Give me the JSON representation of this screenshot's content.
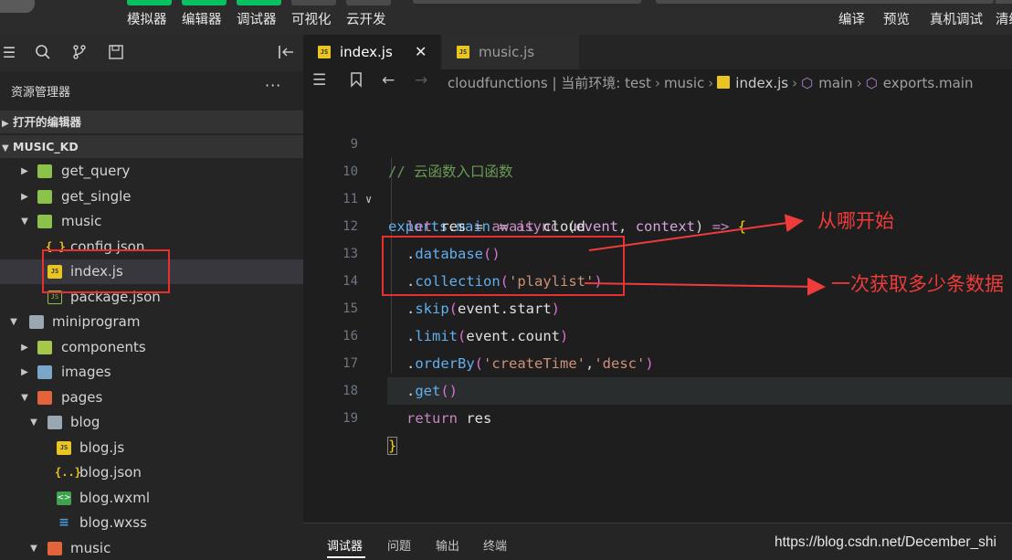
{
  "toolbar": {
    "buttons": [
      "模拟器",
      "编辑器",
      "调试器",
      "可视化",
      "云开发"
    ],
    "right_actions": [
      "编译",
      "预览",
      "真机调试",
      "清缓"
    ]
  },
  "sidebar": {
    "title": "资源管理器",
    "more": "···",
    "sections": [
      "打开的编辑器",
      "MUSIC_KD"
    ],
    "tree": [
      {
        "label": "get_query",
        "icon": "green-folder-icon"
      },
      {
        "label": "get_single",
        "icon": "green-folder-icon"
      },
      {
        "label": "music",
        "icon": "green-folder-open-icon"
      },
      {
        "label": "config.json",
        "icon": "json-file-icon"
      },
      {
        "label": "index.js",
        "icon": "js-file-icon"
      },
      {
        "label": "package.json",
        "icon": "package-json-icon"
      },
      {
        "label": "miniprogram",
        "icon": "folder-open-icon"
      },
      {
        "label": "components",
        "icon": "components-folder-icon"
      },
      {
        "label": "images",
        "icon": "images-folder-icon"
      },
      {
        "label": "pages",
        "icon": "pages-folder-icon"
      },
      {
        "label": "blog",
        "icon": "folder-open-icon"
      },
      {
        "label": "blog.js",
        "icon": "js-file-icon"
      },
      {
        "label": "blog.json",
        "icon": "json-file-icon"
      },
      {
        "label": "blog.wxml",
        "icon": "wxml-file-icon"
      },
      {
        "label": "blog.wxss",
        "icon": "wxss-file-icon"
      },
      {
        "label": "music",
        "icon": "red-folder-icon"
      }
    ]
  },
  "tabs": [
    {
      "label": "index.js",
      "close": "✕"
    },
    {
      "label": "music.js"
    }
  ],
  "breadcrumb": {
    "path": "cloudfunctions | 当前环境: test",
    "folder": "music",
    "file": "index.js",
    "symbol1": "main",
    "symbol2": "exports.main"
  },
  "code": {
    "line_numbers": [
      "9",
      "10",
      "11",
      "12",
      "13",
      "14",
      "15",
      "16",
      "17",
      "18",
      "19"
    ],
    "l9": "// 云函数入口函数",
    "l10_exports": "exports",
    "l10_dot": ".",
    "l10_main": "main",
    "l10_eq": " = ",
    "l10_async": "async",
    "l10_open": " (",
    "l10_event": "event",
    "l10_comma": ", ",
    "l10_context": "context",
    "l10_close": ")",
    "l10_arrow": " => ",
    "l10_brace": "{",
    "l11_let": "let",
    "l11_res": " res ",
    "l11_eq": "= ",
    "l11_await": "await",
    "l11_cloud": " cloud",
    "l12_dot": ".",
    "l12_fn": "database",
    "l12_paren": "()",
    "l13_dot": ".",
    "l13_fn": "collection",
    "l13_open": "(",
    "l13_str": "'playlist'",
    "l13_close": ")",
    "l14_dot": ".",
    "l14_fn": "skip",
    "l14_open": "(",
    "l14_arg": "event.start",
    "l14_close": ")",
    "l15_dot": ".",
    "l15_fn": "limit",
    "l15_open": "(",
    "l15_arg": "event.count",
    "l15_close": ")",
    "l16_dot": ".",
    "l16_fn": "orderBy",
    "l16_open": "(",
    "l16_str1": "'createTime'",
    "l16_comma": ",",
    "l16_str2": "'desc'",
    "l16_close": ")",
    "l17_dot": ".",
    "l17_fn": "get",
    "l17_paren": "()",
    "l18_return": "return",
    "l18_res": " res",
    "l19_brace": "}"
  },
  "annotations": {
    "start": "从哪开始",
    "count": "一次获取多少条数据",
    "color": "#f03b3b"
  },
  "bottom": {
    "tabs": [
      "调试器",
      "问题",
      "输出",
      "终端"
    ],
    "watermark": "https://blog.csdn.net/December_shi"
  },
  "colors": {
    "accent_green": "#07c160",
    "annotation_red": "#e83030"
  }
}
